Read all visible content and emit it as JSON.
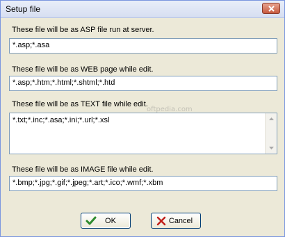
{
  "window": {
    "title": "Setup file"
  },
  "sections": [
    {
      "label": "These file will be as ASP file run at server.",
      "value": "*.asp;*.asa"
    },
    {
      "label": "These file will be as WEB page while edit.",
      "value": "*.asp;*.htm;*.html;*.shtml;*.htd"
    },
    {
      "label": "These file will be as TEXT file while edit.",
      "value": "*.txt;*.inc;*.asa;*.ini;*.url;*.xsl"
    },
    {
      "label": "These file will be as IMAGE file while edit.",
      "value": "*.bmp;*.jpg;*.gif;*.jpeg;*.art;*.ico;*.wmf;*.xbm"
    }
  ],
  "buttons": {
    "ok": "OK",
    "cancel": "Cancel"
  },
  "icons": {
    "close": "close-icon",
    "ok": "checkmark-icon",
    "cancel": "x-cross-icon"
  },
  "watermark": "oftpedia.com",
  "colors": {
    "ok_check": "#2e8b2e",
    "cancel_x": "#c0201b",
    "close_button": "#c75a3f"
  }
}
